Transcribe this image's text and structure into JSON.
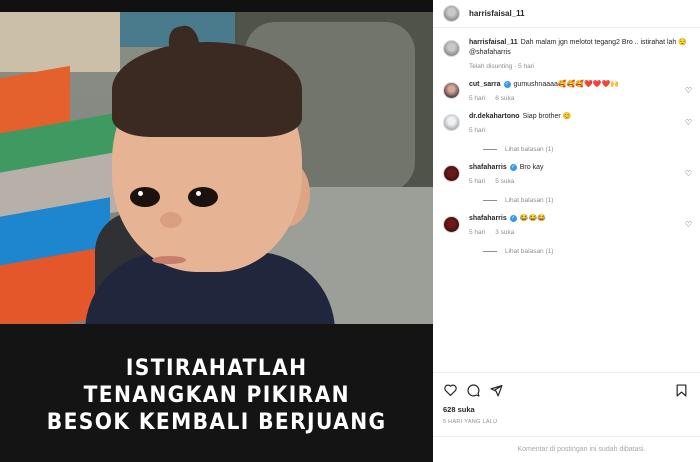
{
  "post": {
    "username": "harrisfaisal_11",
    "caption_user": "harrisfaisal_11",
    "caption_text": "Dah malam jgn melotot tegang2 Bro .. istirahat lah 😌 @shafaharris",
    "caption_meta": "Telah disunting · 5 hari",
    "image_caption": [
      "ISTIRAHATLAH",
      "TENANGKAN PIKIRAN",
      "BESOK KEMBALI BERJUANG"
    ]
  },
  "comments": [
    {
      "user": "cut_sarra",
      "verified": true,
      "text": "gumushnaaaa🥰🥰🥰❤️❤️❤️🙌",
      "time": "5 hari",
      "likes": "6 suka",
      "replies": ""
    },
    {
      "user": "dr.dekahartono",
      "verified": false,
      "text": "Siap brother 😊",
      "time": "5 hari",
      "likes": "",
      "replies": "Lihat balasan (1)"
    },
    {
      "user": "shafaharris",
      "verified": true,
      "text": "Bro kay",
      "time": "5 hari",
      "likes": "5 suka",
      "replies": "Lihat balasan (1)"
    },
    {
      "user": "shafaharris",
      "verified": true,
      "text": "😂😂😂",
      "time": "5 hari",
      "likes": "3 suka",
      "replies": "Lihat balasan (1)"
    }
  ],
  "actions": {
    "likes": "628 suka",
    "time_ago": "5 HARI YANG LALU",
    "comments_disabled": "Komentar di postingan ini sudah dibatasi."
  },
  "icons": {
    "heart": "heart-icon",
    "comment": "comment-icon",
    "share": "share-icon",
    "bookmark": "bookmark-icon"
  }
}
